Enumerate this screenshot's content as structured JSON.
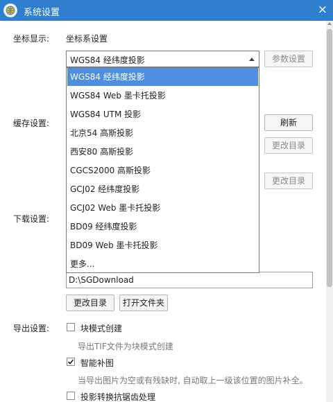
{
  "window": {
    "title": "系统设置",
    "close_glyph": "×"
  },
  "coords": {
    "section_label": "坐标显示:",
    "subheader": "坐标系设置",
    "selected": "WGS84 经纬度投影",
    "param_button": "参数设置",
    "options": [
      "WGS84 经纬度投影",
      "WGS84 Web 墨卡托投影",
      "WGS84 UTM 投影",
      "北京54 高斯投影",
      "西安80 高斯投影",
      "CGCS2000 高斯投影",
      "GCJ02 经纬度投影",
      "GCJ02 Web 墨卡托投影",
      "BD09 经纬度投影",
      "BD09 Web 墨卡托投影",
      "更多..."
    ]
  },
  "cache": {
    "section_label": "缓存设置:",
    "refresh_button": "刷新",
    "change_dir_button_1": "更改目录",
    "change_dir_button_2": "更改目录"
  },
  "download": {
    "section_label": "下载设置:",
    "path": "D:\\SGDownload",
    "change_dir_button": "更改目录",
    "open_folder_button": "打开文件夹"
  },
  "export": {
    "section_label": "导出设置:",
    "block_mode": {
      "label": "块模式创建",
      "checked": false,
      "hint": "导出TIF文件为块模式创建"
    },
    "smart_fill": {
      "label": "智能补图",
      "checked": true,
      "hint": "当导出图片为空或有残缺时, 自动取上一级该位置的图片补全。"
    },
    "antialias": {
      "label": "投影转换抗锯齿处理",
      "checked": false
    }
  },
  "colors": {
    "titlebar": "#2f7fce",
    "selection": "#4e8ee0"
  }
}
